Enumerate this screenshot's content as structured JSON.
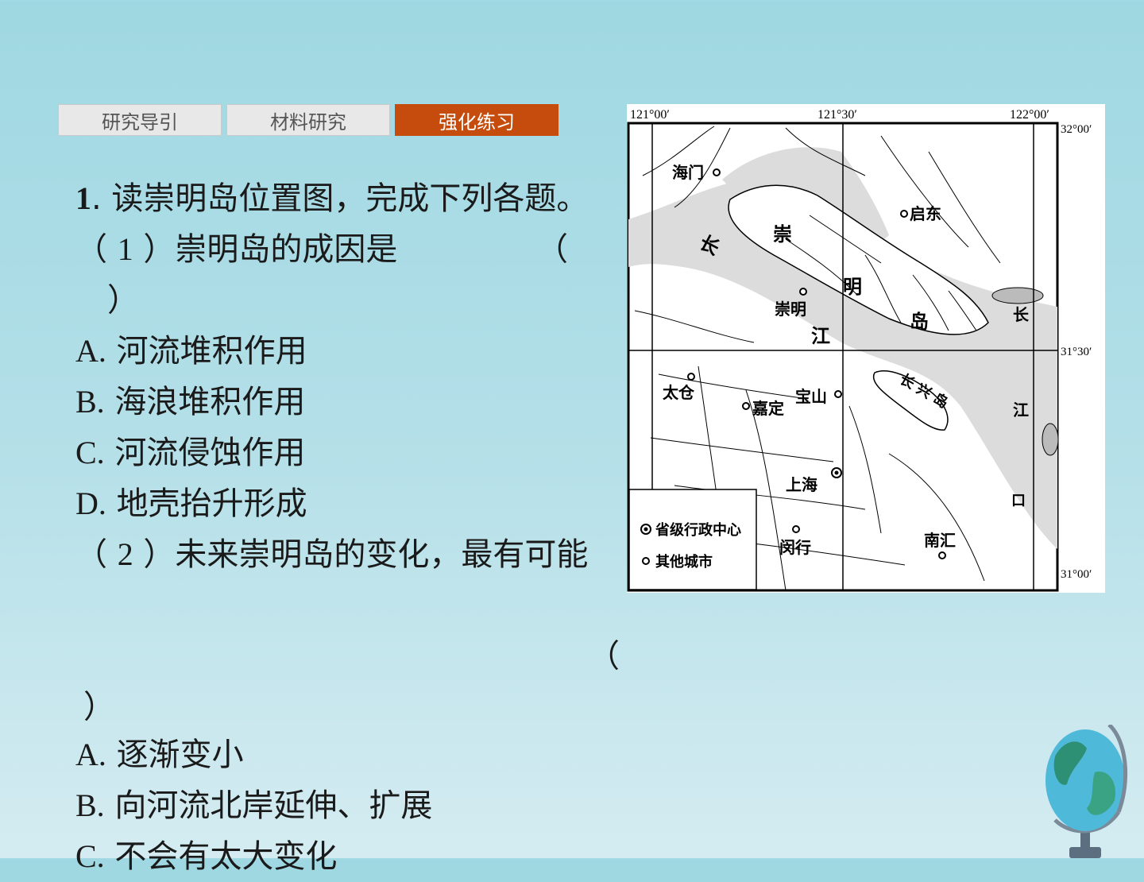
{
  "tabs": [
    {
      "label": "研究导引"
    },
    {
      "label": "材料研究"
    },
    {
      "label": "强化练习"
    }
  ],
  "question": {
    "number": "1",
    "stem": ". 读崇明岛位置图，完成下列各题。",
    "sub1": {
      "open": "（ ",
      "num": "1",
      "text": " ）崇明岛的成因是",
      "paren_open": "（",
      "paren_close": "）",
      "options": [
        {
          "letter": "A.",
          "text": " 河流堆积作用"
        },
        {
          "letter": "B.",
          "text": " 海浪堆积作用"
        },
        {
          "letter": "C.",
          "text": " 河流侵蚀作用"
        },
        {
          "letter": "D.",
          "text": " 地壳抬升形成"
        }
      ]
    },
    "sub2": {
      "open": "（ ",
      "num": "2",
      "text": " ）未来崇明岛的变化，最有可能",
      "paren_open": "（",
      "paren_close": "）",
      "options": [
        {
          "letter": "A.",
          "text": " 逐渐变小"
        },
        {
          "letter": "B.",
          "text": " 向河流北岸延伸、扩展"
        },
        {
          "letter": "C.",
          "text": " 不会有太大变化"
        }
      ]
    }
  },
  "map": {
    "lon_labels": [
      "121°00′",
      "121°30′",
      "122°00′"
    ],
    "lat_labels": [
      "32°00′",
      "31°30′",
      "31°00′"
    ],
    "cities": [
      "海门",
      "启东",
      "崇明",
      "太仓",
      "嘉定",
      "宝山",
      "上海",
      "闵行",
      "南汇"
    ],
    "river_chars": [
      "长",
      "江",
      "长",
      "江",
      "口"
    ],
    "island_chars": [
      "崇",
      "明",
      "岛"
    ],
    "changxing": "长 兴 岛",
    "legend": [
      {
        "symbol": "capital",
        "label": "省级行政中心"
      },
      {
        "symbol": "city",
        "label": "其他城市"
      }
    ]
  }
}
